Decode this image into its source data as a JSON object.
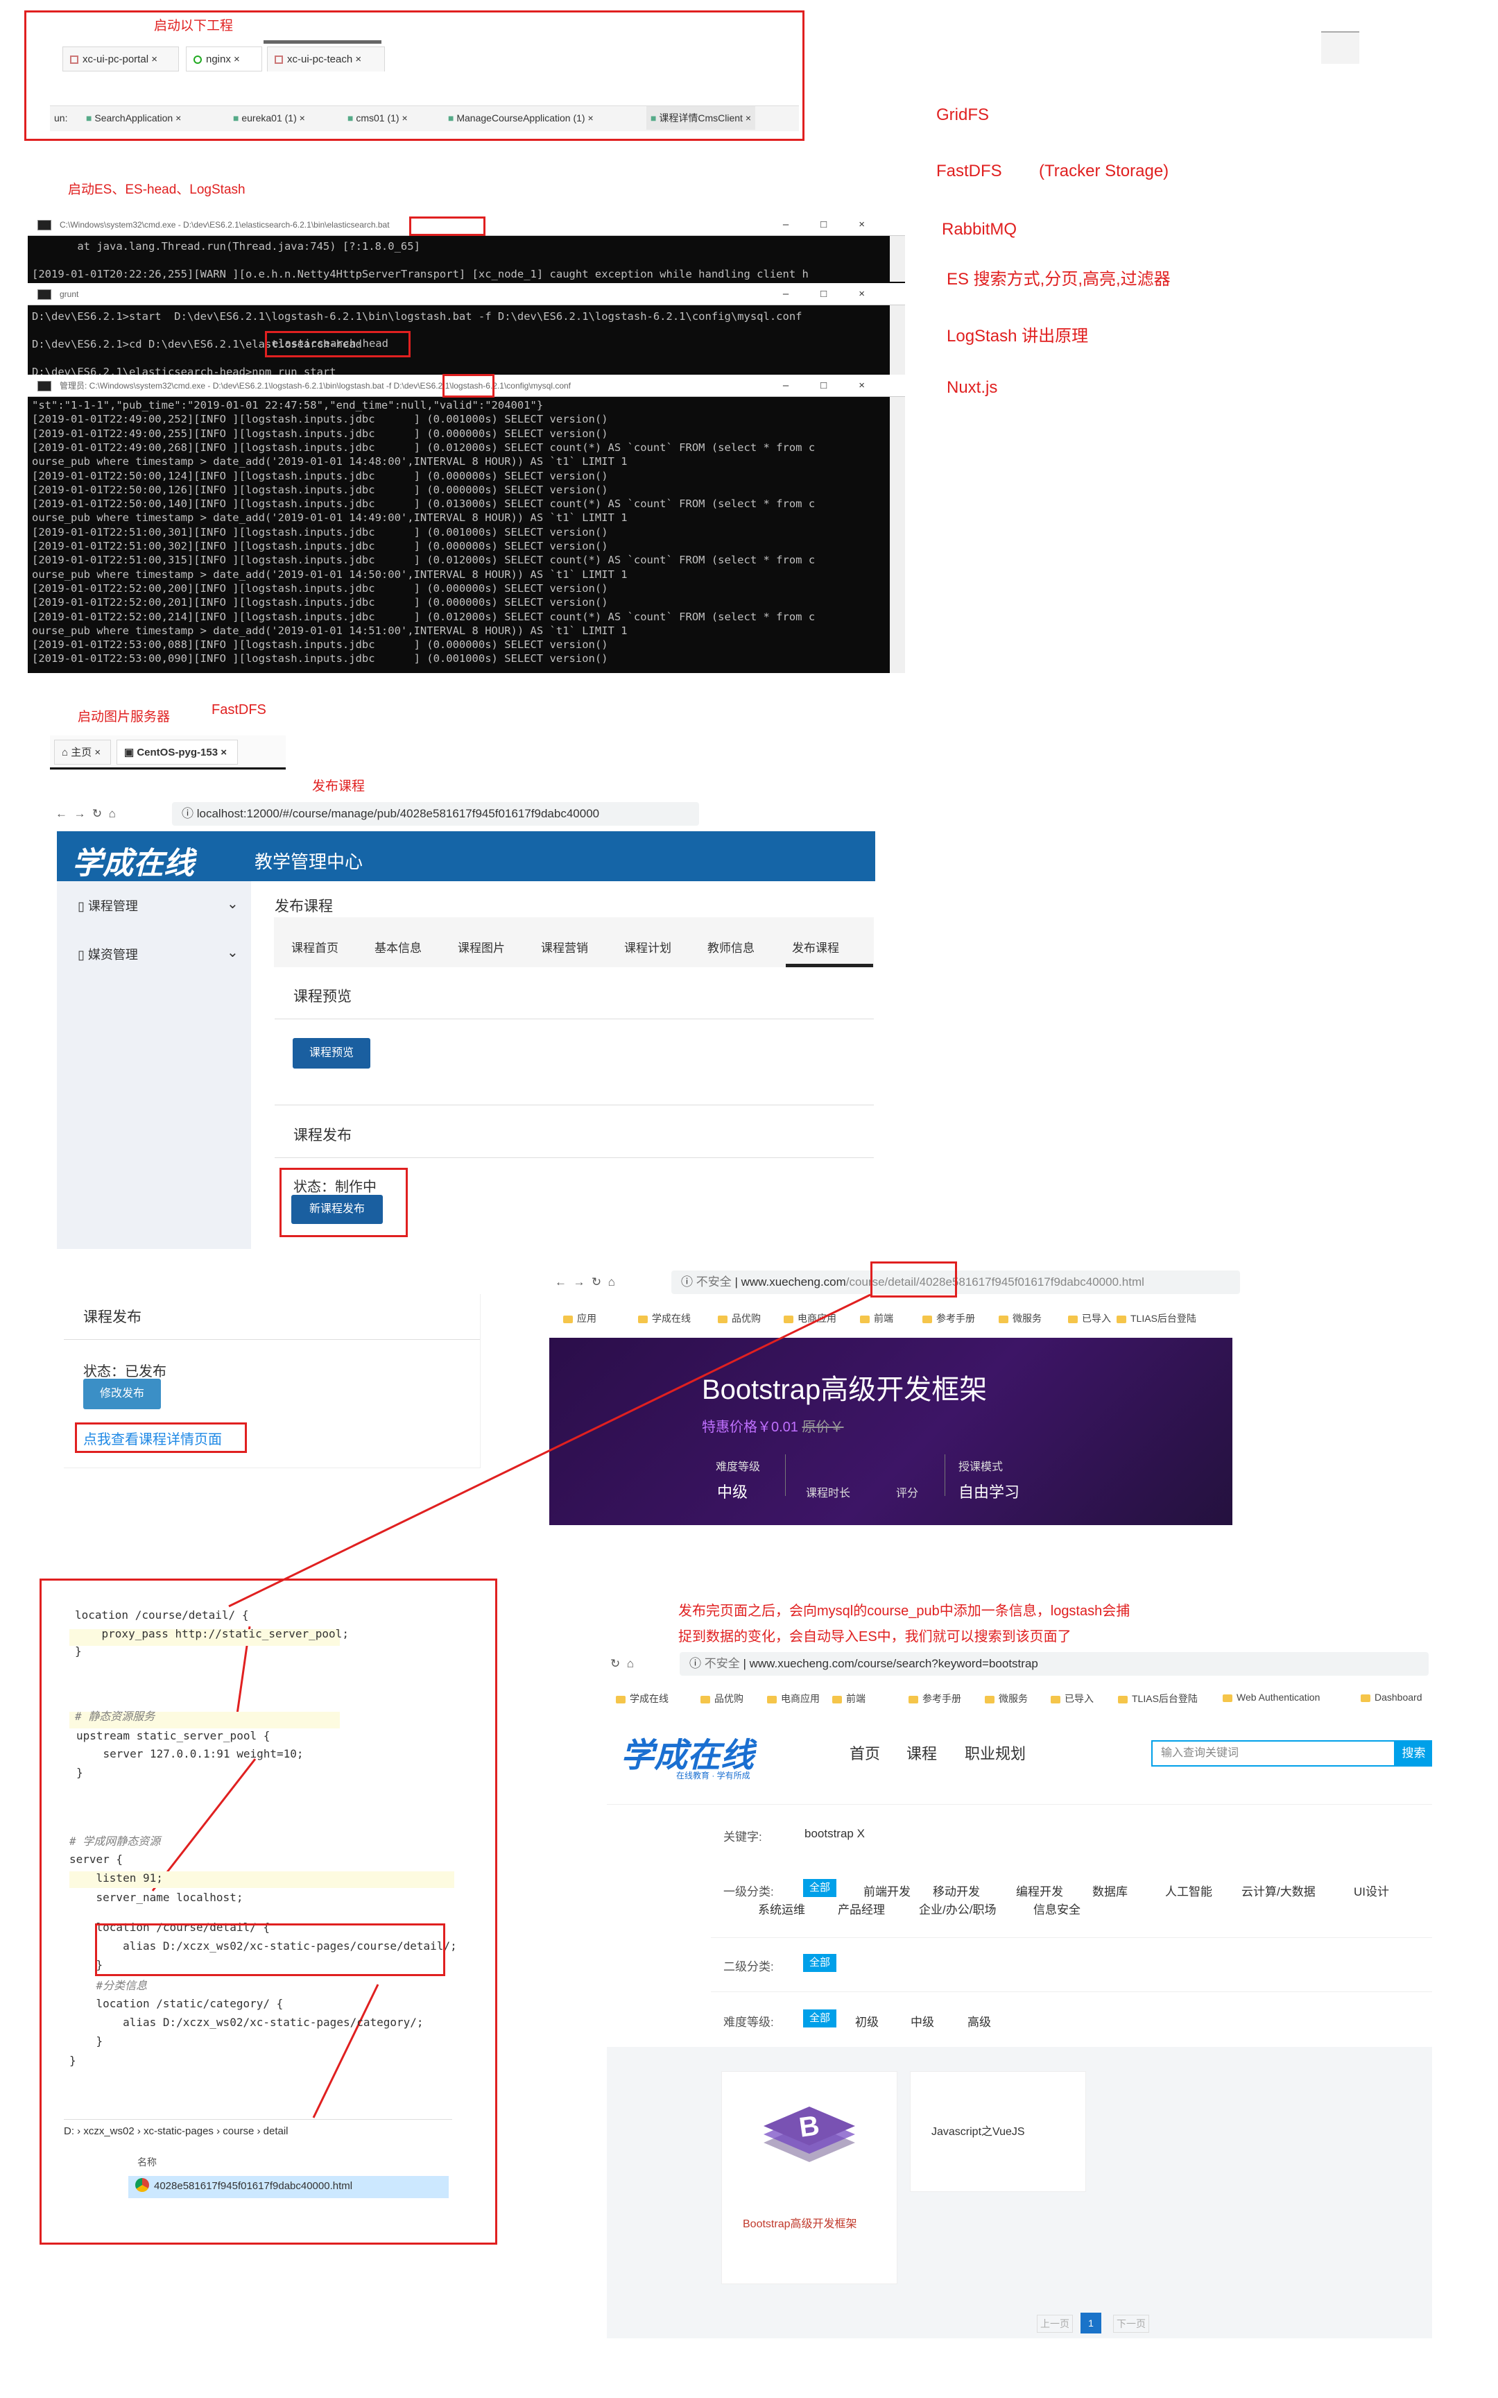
{
  "top": {
    "label_start_projects": "启动以下工程",
    "project_tabs": [
      "xc-ui-pc-portal",
      "nginx",
      "xc-ui-pc-teach"
    ],
    "run_tabs": [
      "un:",
      "SearchApplication",
      "eureka01 (1)",
      "cms01 (1)",
      "ManageCourseApplication (1)",
      "课程详情CmsClient"
    ],
    "label_start_es": "启动ES、ES-head、LogStash",
    "notes": [
      "GridFS",
      "FastDFS",
      "(Tracker Storage)",
      "RabbitMQ",
      "ES 搜索方式,分页,高亮,过滤器",
      "LogStash 讲出原理",
      "Nuxt.js"
    ]
  },
  "consoles": {
    "es_title_prefix": "C:\\Windows\\system32\\cmd.exe - D:\\dev\\ES6.2.1\\elasticsearch-6.2.1\\bin\\",
    "es_title_hl": "elasticsearch.bat",
    "es_lines": [
      "       at java.lang.Thread.run(Thread.java:745) [?:1.8.0_65]",
      "",
      "[2019-01-01T20:22:26,255][WARN ][o.e.h.n.Netty4HttpServerTransport] [xc_node_1] caught exception while handling client h"
    ],
    "grunt_title": "grunt",
    "grunt_lines": [
      "D:\\dev\\ES6.2.1>start  D:\\dev\\ES6.2.1\\logstash-6.2.1\\bin\\logstash.bat -f D:\\dev\\ES6.2.1\\logstash-6.2.1\\config\\mysql.conf",
      "",
      "D:\\dev\\ES6.2.1>cd D:\\dev\\ES6.2.1\\elasticsearch-head",
      "",
      "D:\\dev\\ES6.2.1\\elasticsearch-head>npm run start"
    ],
    "logstash_title_prefix": "管理员: C:\\Windows\\system32\\cmd.exe - D:\\dev\\ES6.2.1\\logstash-6.2.1\\bin\\",
    "logstash_title_hl": "logstash",
    "logstash_title_suffix": ".bat  -f D:\\dev\\ES6.2.1\\logstash-6.2.1\\config\\mysql.conf",
    "logstash_lines": [
      "\"st\":\"1-1-1\",\"pub_time\":\"2019-01-01 22:47:58\",\"end_time\":null,\"valid\":\"204001\"}",
      "[2019-01-01T22:49:00,252][INFO ][logstash.inputs.jdbc      ] (0.001000s) SELECT version()",
      "[2019-01-01T22:49:00,255][INFO ][logstash.inputs.jdbc      ] (0.000000s) SELECT version()",
      "[2019-01-01T22:49:00,268][INFO ][logstash.inputs.jdbc      ] (0.012000s) SELECT count(*) AS `count` FROM (select * from c",
      "ourse_pub where timestamp > date_add('2019-01-01 14:48:00',INTERVAL 8 HOUR)) AS `t1` LIMIT 1",
      "[2019-01-01T22:50:00,124][INFO ][logstash.inputs.jdbc      ] (0.000000s) SELECT version()",
      "[2019-01-01T22:50:00,126][INFO ][logstash.inputs.jdbc      ] (0.000000s) SELECT version()",
      "[2019-01-01T22:50:00,140][INFO ][logstash.inputs.jdbc      ] (0.013000s) SELECT count(*) AS `count` FROM (select * from c",
      "ourse_pub where timestamp > date_add('2019-01-01 14:49:00',INTERVAL 8 HOUR)) AS `t1` LIMIT 1",
      "[2019-01-01T22:51:00,301][INFO ][logstash.inputs.jdbc      ] (0.001000s) SELECT version()",
      "[2019-01-01T22:51:00,302][INFO ][logstash.inputs.jdbc      ] (0.000000s) SELECT version()",
      "[2019-01-01T22:51:00,315][INFO ][logstash.inputs.jdbc      ] (0.012000s) SELECT count(*) AS `count` FROM (select * from c",
      "ourse_pub where timestamp > date_add('2019-01-01 14:50:00',INTERVAL 8 HOUR)) AS `t1` LIMIT 1",
      "[2019-01-01T22:52:00,200][INFO ][logstash.inputs.jdbc      ] (0.000000s) SELECT version()",
      "[2019-01-01T22:52:00,201][INFO ][logstash.inputs.jdbc      ] (0.000000s) SELECT version()",
      "[2019-01-01T22:52:00,214][INFO ][logstash.inputs.jdbc      ] (0.012000s) SELECT count(*) AS `count` FROM (select * from c",
      "ourse_pub where timestamp > date_add('2019-01-01 14:51:00',INTERVAL 8 HOUR)) AS `t1` LIMIT 1",
      "[2019-01-01T22:53:00,088][INFO ][logstash.inputs.jdbc      ] (0.000000s) SELECT version()",
      "[2019-01-01T22:53:00,090][INFO ][logstash.inputs.jdbc      ] (0.001000s) SELECT version()"
    ],
    "head_box_text": "elasticsearch-head"
  },
  "fastdfs": {
    "label_start_image": "启动图片服务器",
    "label_fastdfs": "FastDFS",
    "tabs": [
      "主页",
      "CentOS-pyg-153"
    ]
  },
  "publish": {
    "label": "发布课程",
    "url": "localhost:12000/#/course/manage/pub/4028e581617f945f01617f9dabc40000",
    "logo": "学成在线",
    "header_title": "教学管理中心",
    "side_items": [
      "课程管理",
      "媒资管理"
    ],
    "page_title": "发布课程",
    "tabs": [
      "课程首页",
      "基本信息",
      "课程图片",
      "课程营销",
      "课程计划",
      "教师信息",
      "发布课程"
    ],
    "preview_section": "课程预览",
    "preview_button": "课程预览",
    "publish_section": "课程发布",
    "status": "状态：制作中",
    "new_publish_button": "新课程发布"
  },
  "published_card": {
    "title": "课程发布",
    "status": "状态：已发布",
    "modify_button": "修改发布",
    "link": "点我查看课程详情页面"
  },
  "detail_page": {
    "insecure": "不安全",
    "url_host": "www.xuecheng.com",
    "url_hl": "/course/detail/",
    "url_rest": "4028e581617f945f01617f9dabc40000.html",
    "bookmarks": [
      "应用",
      "学成在线",
      "品优购",
      "电商应用",
      "前端",
      "参考手册",
      "微服务",
      "已导入",
      "TLIAS后台登陆"
    ],
    "banner_title": "Bootstrap高级开发框架",
    "price": "特惠价格￥0.01",
    "orig_price": "原价￥",
    "level_label": "难度等级",
    "level": "中级",
    "duration": "课程时长",
    "rating": "评分",
    "mode_label": "授课模式",
    "mode": "自由学习"
  },
  "nginx": {
    "lines": [
      {
        "t": "location /course/detail/ {",
        "k": "loc1"
      },
      {
        "t": "    proxy_pass http://static_server_pool;",
        "k": "p"
      },
      {
        "t": "}",
        "k": "p"
      },
      {
        "t": "# 静态资源服务",
        "k": "c"
      },
      {
        "t": "upstream static_server_pool {",
        "k": "up"
      },
      {
        "t": "    server 127.0.0.1:91 weight=10;",
        "k": "p"
      },
      {
        "t": "}",
        "k": "p"
      },
      {
        "t": "# 学成网静态资源",
        "k": "c"
      },
      {
        "t": "server {",
        "k": "p"
      },
      {
        "t": "    listen 91;",
        "k": "p"
      },
      {
        "t": "    server_name localhost;",
        "k": "p"
      },
      {
        "t": "    location /course/detail/ {",
        "k": "p"
      },
      {
        "t": "        alias D:/xczx_ws02/xc-static-pages/course/detail/;",
        "k": "p"
      },
      {
        "t": "    }",
        "k": "p"
      },
      {
        "t": "    #分类信息",
        "k": "c"
      },
      {
        "t": "    location /static/category/ {",
        "k": "p"
      },
      {
        "t": "        alias D:/xczx_ws02/xc-static-pages/category/;",
        "k": "p"
      },
      {
        "t": "    }",
        "k": "p"
      },
      {
        "t": "}",
        "k": "p"
      }
    ],
    "breadcrumb": [
      "D:",
      "xczx_ws02",
      "xc-static-pages",
      "course",
      "detail"
    ],
    "col_name": "名称",
    "file": "4028e581617f945f01617f9dabc40000.html"
  },
  "note": {
    "line1": "发布完页面之后，会向mysql的course_pub中添加一条信息，logstash会捕",
    "line2": "捉到数据的变化，会自动导入ES中，我们就可以搜索到该页面了"
  },
  "search_page": {
    "insecure": "不安全",
    "url": "www.xuecheng.com/course/search?keyword=bootstrap",
    "bookmarks": [
      "学成在线",
      "品优购",
      "电商应用",
      "前端",
      "参考手册",
      "微服务",
      "已导入",
      "TLIAS后台登陆",
      "Web Authentication",
      "Dashboard"
    ],
    "logo": "学成在线",
    "logo_sub": "在线教育 · 学有所成",
    "nav": [
      "首页",
      "课程",
      "职业规划"
    ],
    "search_placeholder": "输入查询关键词",
    "search_button": "搜索",
    "keyword_label": "关键字:",
    "keyword_value": "bootstrap X",
    "cat1_label": "一级分类:",
    "cat1_all": "全部",
    "cat1_items": [
      "前端开发",
      "移动开发",
      "编程开发",
      "数据库",
      "人工智能",
      "云计算/大数据",
      "UI设计"
    ],
    "cat1_items_row2": [
      "系统运维",
      "产品经理",
      "企业/办公/职场",
      "信息安全"
    ],
    "cat2_label": "二级分类:",
    "cat2_all": "全部",
    "level_label": "难度等级:",
    "level_all": "全部",
    "levels": [
      "初级",
      "中级",
      "高级"
    ],
    "course1": "Bootstrap高级开发框架",
    "course2": "Javascript之VueJS",
    "pager_prev": "上一页",
    "pager_page": "1",
    "pager_next": "下一页"
  }
}
